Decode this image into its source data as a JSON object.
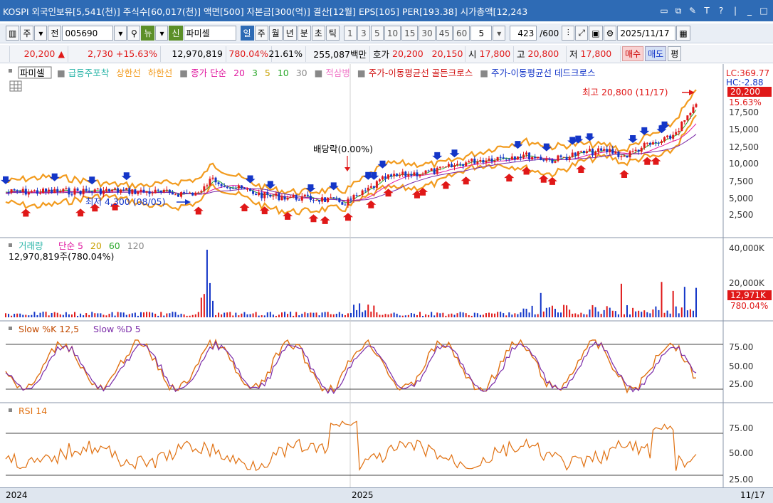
{
  "titlebar": {
    "text": "KOSPI 외국인보유[5,541(천)] 주식수[60,017(천)] 액면[500] 자본금[300(억)] 결산[12월] EPS[105] PER[193.38] 시가총액[12,243",
    "ctrl_icons": [
      "window-icon",
      "restore-icon",
      "pin-icon",
      "font-icon",
      "help-icon",
      "minimize-icon",
      "maximize-icon"
    ]
  },
  "toolbar": {
    "type_label": "주",
    "prev_label": "전",
    "code": "005690",
    "new_label": "뉴",
    "sin_label": "신",
    "name": "파미셀",
    "periods": [
      "일",
      "주",
      "월",
      "년",
      "분",
      "초",
      "틱"
    ],
    "active_period": "일",
    "intervals": [
      "1",
      "3",
      "5",
      "10",
      "15",
      "30",
      "45",
      "60"
    ],
    "interval_input": "5",
    "count": "423",
    "count_total": "/600",
    "date": "2025/11/17"
  },
  "quote": {
    "price": "20,200",
    "change": "2,730",
    "change_pct": "+15.63%",
    "volume": "12,970,819",
    "volume_pct": "780.04%",
    "turnover": "21.61%",
    "amount": "255,087백만",
    "bid_label": "호가",
    "bid_price1": "20,200",
    "bid_price2": "20,150",
    "open_label": "시",
    "open": "17,800",
    "high_label": "고",
    "high": "20,800",
    "low_label": "저",
    "low": "17,800",
    "buy_label": "매수",
    "sell_label": "매도",
    "eval_label": "평"
  },
  "price_panel": {
    "legend_name": "파미셀",
    "legend_items": [
      {
        "text": "급등주포착",
        "color": "#2ab5a8"
      },
      {
        "text": "상한선",
        "color": "#f29b1e"
      },
      {
        "text": "하한선",
        "color": "#f29b1e"
      },
      {
        "text": "종가 단순",
        "color": "#e01aa0"
      },
      {
        "text": "20",
        "color": "#e01aa0"
      },
      {
        "text": "3",
        "color": "#2aa82a"
      },
      {
        "text": "5",
        "color": "#c8a000"
      },
      {
        "text": "10",
        "color": "#2aa82a"
      },
      {
        "text": "30",
        "color": "#888888"
      },
      {
        "text": "적삼병",
        "color": "#f07ac8"
      },
      {
        "text": "주가-이동평균선 골든크로스",
        "color": "#d01010"
      },
      {
        "text": "주가-이동평균선 데드크로스",
        "color": "#1436c8"
      }
    ],
    "lc": "LC:369.77",
    "hc": "HC:-2.88",
    "last_price": "20,200",
    "last_pct": "15.63%",
    "yaxis": [
      "17,500",
      "15,000",
      "12,500",
      "10,000",
      "7,500",
      "5,000",
      "2,500"
    ],
    "high_note": "최고 20,800 (11/17)",
    "low_note": "최저 4,300 (08/05)",
    "dividend_note": "배당락(0.00%)"
  },
  "volume_panel": {
    "title": "거래량",
    "legend": [
      {
        "text": "단순 5",
        "color": "#e01aa0"
      },
      {
        "text": "20",
        "color": "#c8a000"
      },
      {
        "text": "60",
        "color": "#2aa82a"
      },
      {
        "text": "120",
        "color": "#888888"
      }
    ],
    "value_note": "12,970,819주(780.04%)",
    "yaxis": [
      "40,000K",
      "20,000K"
    ],
    "last_value": "12,971K",
    "last_pct": "780.04%"
  },
  "stoch_panel": {
    "title": "Slow %K 12,5",
    "title2": "Slow %D 5",
    "yaxis": [
      "75.00",
      "50.00",
      "25.00"
    ]
  },
  "rsi_panel": {
    "title": "RSI 14",
    "yaxis": [
      "75.00",
      "50.00",
      "25.00"
    ]
  },
  "xaxis": {
    "labels": [
      "2024",
      "2025"
    ],
    "last_date": "11/17"
  },
  "colors": {
    "titlebar": "#2e6bb5",
    "up": "#e01818",
    "down": "#1436c8",
    "band": "#f29b1e"
  }
}
